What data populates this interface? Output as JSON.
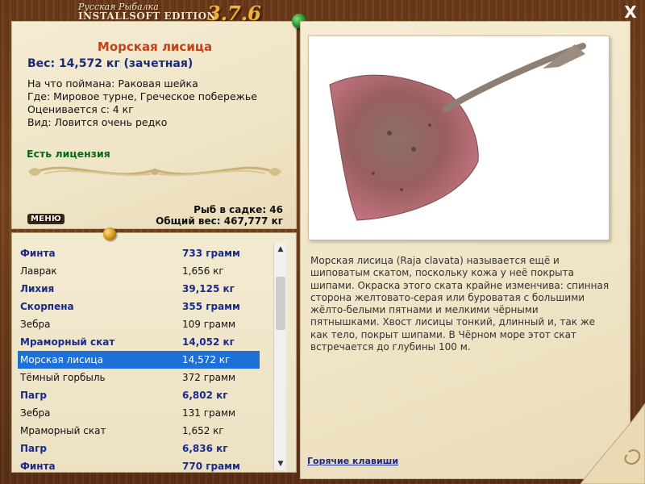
{
  "app": {
    "logo_line1": "Русская Рыбалка",
    "logo_line2": "INSTALLSOFT EDITION",
    "version": "3.7.6",
    "close_label": "X"
  },
  "fish": {
    "name": "Морская лисица",
    "weight": "Вес: 14,572 кг (зачетная)",
    "caught_on": "На что поймана: Раковая шейка",
    "location": "Где: Мировое турне, Греческое побережье",
    "valued_from": "Оценивается с: 4 кг",
    "rarity": "Вид: Ловится очень редко",
    "license": "Есть лицензия",
    "description": "Морская лисица (Raja clavata) называется ещё и шиповатым скатом, поскольку кожа у неё покрыта шипами. Окраска этого ската крайне изменчива: спинная сторона желтовато-серая или буроватая с большими жёлто-белыми пятнами и мелкими чёрными пятнышками. Хвост лисицы тонкий, длинный и, так же как тело, покрыт шипами. В Чёрном море этот скат встречается до глубины 100 м."
  },
  "menu_label": "МЕНЮ",
  "stats": {
    "fish_in_keepnet": "Рыб в садке: 46",
    "total_weight": "Общий вес: 467,777 кг"
  },
  "catch_list": [
    {
      "name": "Финта",
      "weight": "733 грамм",
      "style": "bold"
    },
    {
      "name": "Лаврак",
      "weight": "1,656 кг",
      "style": "norm"
    },
    {
      "name": "Лихия",
      "weight": "39,125 кг",
      "style": "bold"
    },
    {
      "name": "Скорпена",
      "weight": "355 грамм",
      "style": "bold"
    },
    {
      "name": "Зебра",
      "weight": "109 грамм",
      "style": "norm"
    },
    {
      "name": "Мраморный скат",
      "weight": "14,052 кг",
      "style": "bold"
    },
    {
      "name": "Морская лисица",
      "weight": "14,572 кг",
      "style": "sel"
    },
    {
      "name": "Тёмный горбыль",
      "weight": "372 грамм",
      "style": "norm"
    },
    {
      "name": "Пагр",
      "weight": "6,802 кг",
      "style": "bold"
    },
    {
      "name": "Зебра",
      "weight": "131 грамм",
      "style": "norm"
    },
    {
      "name": "Мраморный скат",
      "weight": "1,652 кг",
      "style": "norm"
    },
    {
      "name": "Пагр",
      "weight": "6,836 кг",
      "style": "bold"
    },
    {
      "name": "Финта",
      "weight": "770 грамм",
      "style": "bold"
    }
  ],
  "hotkeys_link": "Горячие клавиши",
  "colors": {
    "title_red": "#c0431a",
    "weight_blue": "#1a2a7a",
    "license_green": "#0a6a14",
    "selection_blue": "#1e6fd6"
  },
  "icons": {
    "close": "close-icon",
    "pin_green": "green-pushpin-icon",
    "pin_gold": "gold-pushpin-icon",
    "scroll_up": "scroll-up-arrow-icon",
    "scroll_down": "scroll-down-arrow-icon"
  }
}
